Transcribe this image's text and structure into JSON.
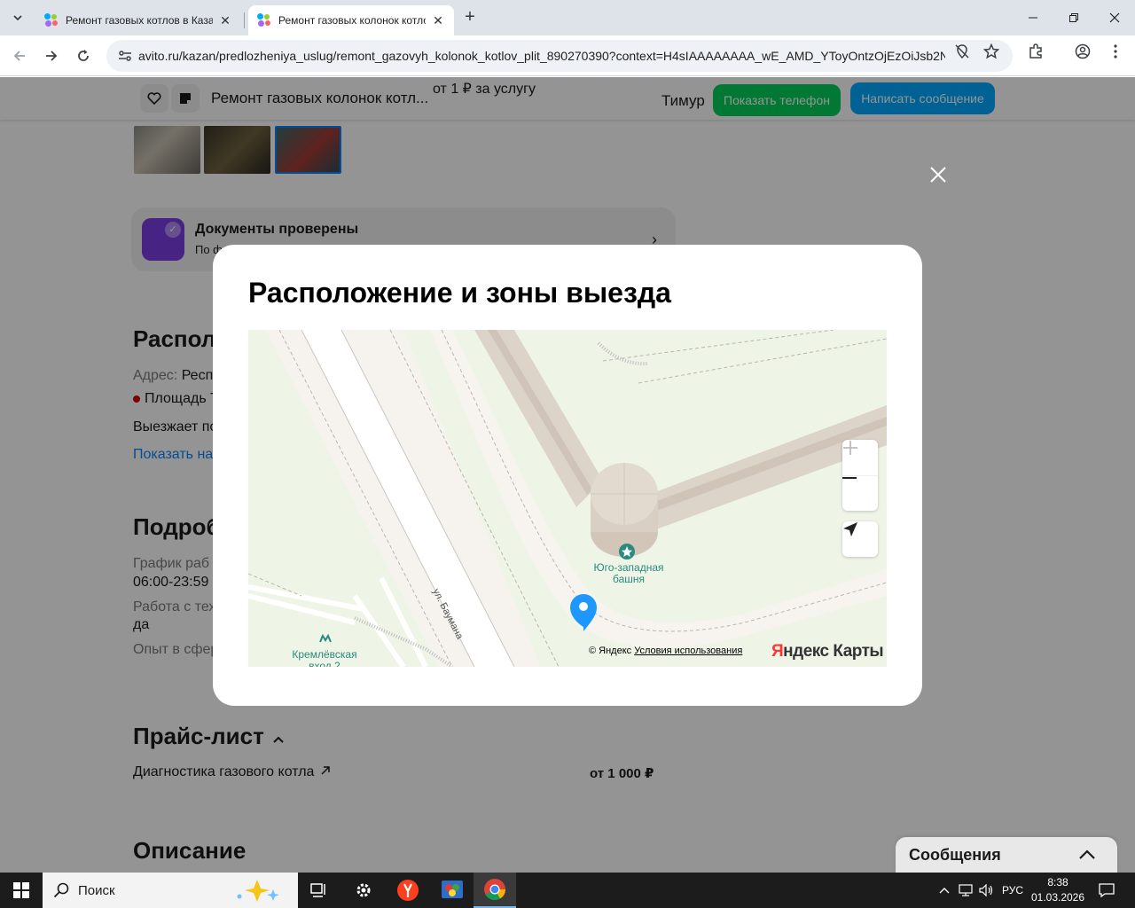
{
  "browser": {
    "tabs": [
      {
        "title": "Ремонт газовых котлов в Казан",
        "active": false
      },
      {
        "title": "Ремонт газовых колонок котло",
        "active": true
      }
    ],
    "url": "avito.ru/kazan/predlozheniya_uslug/remont_gazovyh_kolonok_kotlov_plit_890270390?context=H4sIAAAAAAAA_wE_AMD_YToyOntzOjEzOiJsb2Nh..."
  },
  "header": {
    "title": "Ремонт газовых колонок котл...",
    "price": "от 1 ₽ за услугу",
    "seller": "Тимур",
    "show_phone": "Показать телефон",
    "write_message": "Написать сообщение"
  },
  "docs": {
    "title": "Документы проверены",
    "subtitle": "По ф"
  },
  "location": {
    "heading": "Располо",
    "address_label": "Адрес:",
    "address_value": "Респ",
    "metro": "Площадь Т",
    "travels": "Выезжает по",
    "show_link": "Показать на"
  },
  "details": {
    "heading": "Подроб",
    "schedule_label": "График раб",
    "schedule_value": "06:00-23:59",
    "equipment_label": "Работа с тех",
    "equipment_value": "да",
    "experience_label": "Опыт в сфер"
  },
  "pricelist": {
    "heading": "Прайс-лист",
    "items": [
      {
        "name": "Диагностика газового котла",
        "price": "от 1 000 ₽"
      }
    ]
  },
  "description": {
    "heading": "Описание"
  },
  "modal": {
    "title": "Расположение и зоны выезда",
    "map": {
      "poi_tower": "Юго-западная\nбашня",
      "street": "ул. Баумана",
      "metro_exit": "Кремлёвская\nвход 2",
      "copyright": "© Яндекс",
      "terms": "Условия использования",
      "logo_ya": "Я",
      "logo_rest": "ндекс Карты"
    }
  },
  "messages_widget": {
    "label": "Сообщения"
  },
  "taskbar": {
    "search": "Поиск",
    "lang": "РУС",
    "time": "8:38",
    "date": "01.03.2026"
  },
  "colors": {
    "avito_green": "#02d15c",
    "avito_blue": "#00aaff",
    "map_pin": "#1e98ff"
  }
}
